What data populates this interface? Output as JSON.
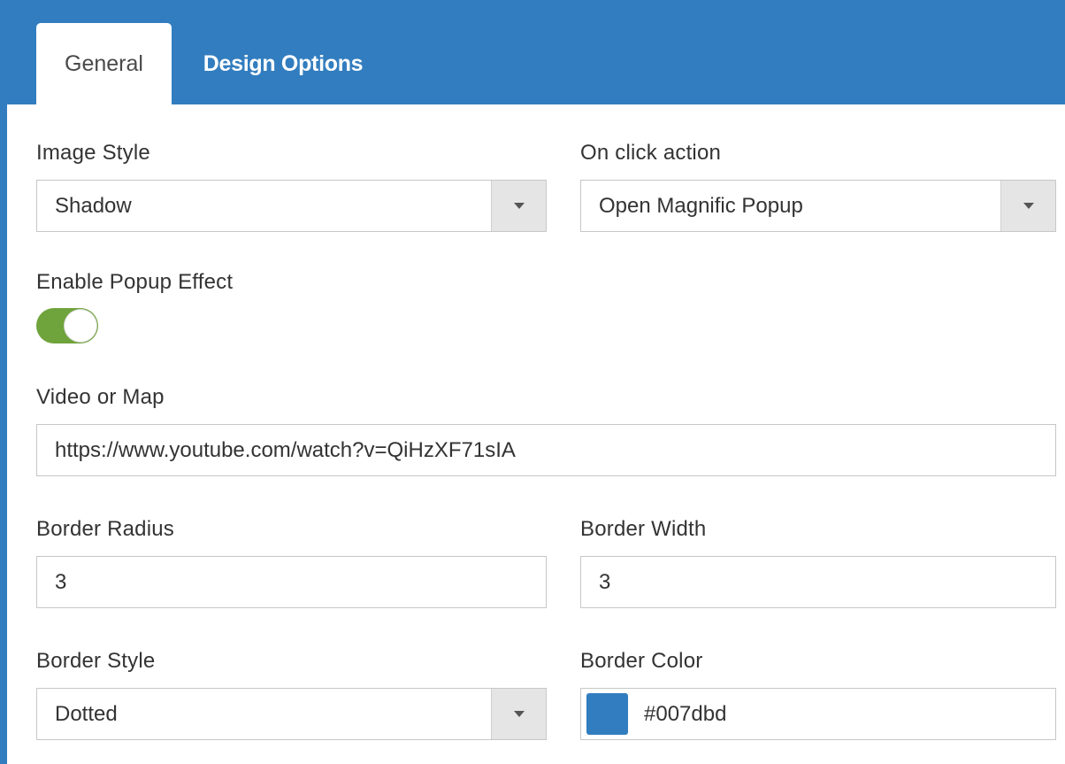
{
  "tabs": [
    {
      "label": "General",
      "active": true
    },
    {
      "label": "Design Options",
      "active": false
    }
  ],
  "image_style": {
    "label": "Image Style",
    "value": "Shadow"
  },
  "on_click_action": {
    "label": "On click action",
    "value": "Open Magnific Popup"
  },
  "popup_effect": {
    "label": "Enable Popup Effect",
    "enabled": true
  },
  "video_or_map": {
    "label": "Video or Map",
    "value": "https://www.youtube.com/watch?v=QiHzXF71sIA"
  },
  "border_radius": {
    "label": "Border Radius",
    "value": "3"
  },
  "border_width": {
    "label": "Border Width",
    "value": "3"
  },
  "border_style": {
    "label": "Border Style",
    "value": "Dotted"
  },
  "border_color": {
    "label": "Border Color",
    "value": "#007dbd"
  },
  "colors": {
    "accent": "#327dbf",
    "toggle_on": "#6fa33b",
    "dropdown_button": "#e5e5e5",
    "input_border": "#c7c7c7"
  },
  "icons": {
    "dropdown": "caret-down-icon",
    "toggle_knob": "toggle-knob-icon"
  }
}
